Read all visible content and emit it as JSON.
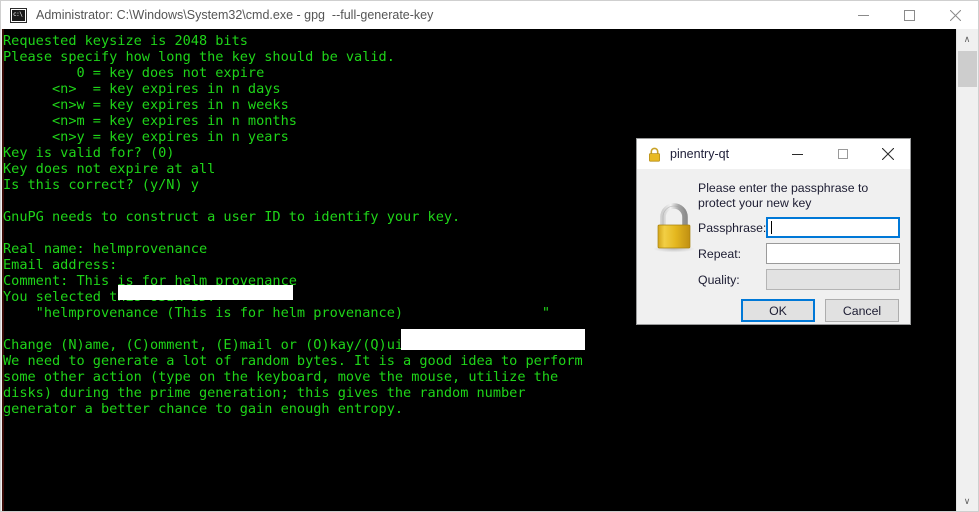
{
  "window": {
    "title": "Administrator: C:\\Windows\\System32\\cmd.exe - gpg  --full-generate-key",
    "icon": "cmd-icon",
    "controls": {
      "minimize": "minimize-button",
      "maximize": "maximize-button",
      "close": "close-button"
    }
  },
  "console": {
    "foreground_color": "#1fd519",
    "background_color": "#000000",
    "text": "Requested keysize is 2048 bits\nPlease specify how long the key should be valid.\n         0 = key does not expire\n      <n>  = key expires in n days\n      <n>w = key expires in n weeks\n      <n>m = key expires in n months\n      <n>y = key expires in n years\nKey is valid for? (0)\nKey does not expire at all\nIs this correct? (y/N) y\n\nGnuPG needs to construct a user ID to identify your key.\n\nReal name: helmprovenance\nEmail address:\nComment: This is for helm provenance\nYou selected this USER-ID:\n    \"helmprovenance (This is for helm provenance)                 \"\n\nChange (N)ame, (C)omment, (E)mail or (O)kay/(Q)uit? O\nWe need to generate a lot of random bytes. It is a good idea to perform\nsome other action (type on the keyboard, move the mouse, utilize the\ndisks) during the prime generation; this gives the random number\ngenerator a better chance to gain enough entropy.",
    "redactions": [
      {
        "name": "email-address-redaction"
      },
      {
        "name": "user-id-redaction"
      }
    ],
    "scrollbar": {
      "up_arrow": "∧",
      "down_arrow": "∨"
    }
  },
  "dialog": {
    "title": "pinentry-qt",
    "icon": "lock-icon",
    "prompt": "Please enter the passphrase to protect your new key",
    "fields": [
      {
        "label": "Passphrase:",
        "value": "",
        "state": "focused"
      },
      {
        "label": "Repeat:",
        "value": "",
        "state": "normal"
      },
      {
        "label": "Quality:",
        "value": "",
        "state": "disabled"
      }
    ],
    "buttons": {
      "ok": "OK",
      "cancel": "Cancel"
    },
    "controls": {
      "minimize": "minimize-button",
      "maximize": "maximize-button",
      "close": "close-button"
    },
    "accent_color": "#0078d7"
  }
}
